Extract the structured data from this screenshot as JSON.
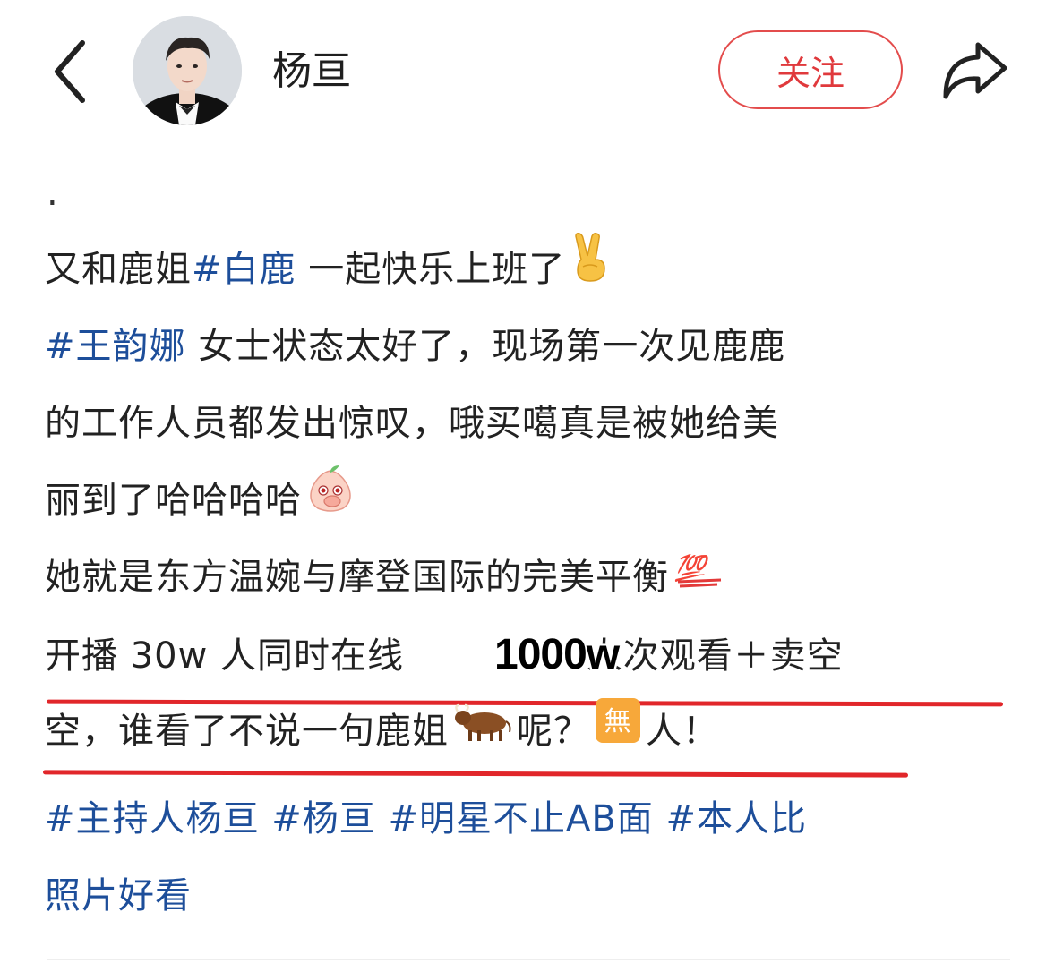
{
  "header": {
    "username": "杨亘",
    "follow_label": "关注"
  },
  "post": {
    "dot": ".",
    "line1": {
      "text_a": "又和鹿姐",
      "tag": "#白鹿",
      "text_b": " 一起快乐上班了"
    },
    "line2": {
      "tag": "#王韵娜",
      "text": " 女士状态太好了，现场第一次见鹿鹿"
    },
    "line3": {
      "text": "的工作人员都发出惊叹，哦买噶真是被她给美"
    },
    "line4": {
      "text": "丽到了哈哈哈哈"
    },
    "line5": {
      "text": "她就是东方温婉与摩登国际的完美平衡"
    },
    "line6": {
      "text_a": "开播 30w 人同时在线 ",
      "text_b": "人次观看＋卖空"
    },
    "overlay": "1000w",
    "line7": {
      "text_a": "空，谁看了不说一句鹿姐",
      "text_b": "呢？",
      "text_c": "人！"
    },
    "emoji_100": "💯",
    "emoji_wu": "無",
    "line8": {
      "tags": [
        "#主持人杨亘",
        "#杨亘",
        "#明星不止AB面",
        "#本人比"
      ]
    },
    "line9": {
      "tag_cont": "照片好看"
    }
  },
  "colors": {
    "accent_red": "#e0393c",
    "hashtag_blue": "#1d4e9a",
    "underline_red": "#e1262a"
  },
  "icons": [
    "back-arrow-icon",
    "avatar",
    "share-icon",
    "victory-hand-emoji",
    "peach-face-emoji",
    "hundred-points-emoji",
    "ox-emoji",
    "wu-char-emoji"
  ]
}
